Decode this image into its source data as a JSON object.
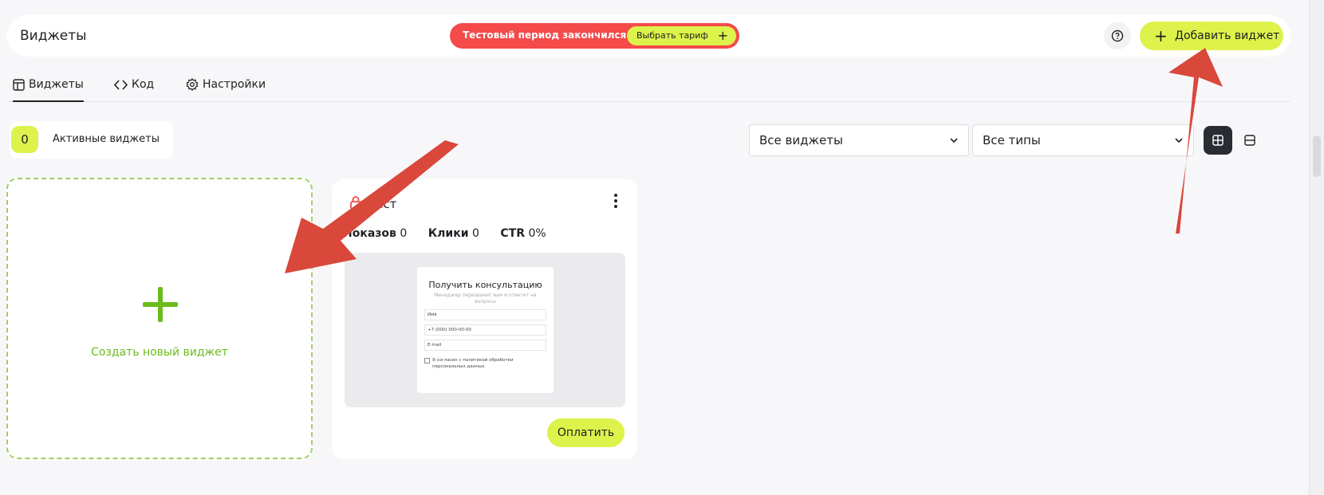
{
  "header": {
    "title": "Виджеты",
    "trial_text": "Тестовый период закончился",
    "tariff_label": "Выбрать тариф",
    "add_label": "Добавить виджет"
  },
  "tabs": [
    {
      "label": "Виджеты",
      "icon": "layout-icon",
      "active": true
    },
    {
      "label": "Код",
      "icon": "code-icon",
      "active": false
    },
    {
      "label": "Настройки",
      "icon": "gear-icon",
      "active": false
    }
  ],
  "active_widgets": {
    "count": "0",
    "label": "Активные виджеты"
  },
  "filters": {
    "widgets": "Все виджеты",
    "types": "Все типы"
  },
  "create_card": {
    "label": "Создать новый виджет"
  },
  "widget": {
    "name": "Тест",
    "stats": {
      "impressions_label": "Показов",
      "impressions": "0",
      "clicks_label": "Клики",
      "clicks": "0",
      "ctr_label": "CTR",
      "ctr": "0%"
    },
    "preview": {
      "title": "Получить консультацию",
      "subtitle": "Менеджер перезвонит вам и ответит на вопросы",
      "field_name": "Имя",
      "field_phone": "+7 (000) 000-00-00",
      "field_email": "E-mail",
      "consent": "Я согласен с политикой обработки персональных данных"
    },
    "pay_label": "Оплатить"
  },
  "colors": {
    "accent": "#ddf24b",
    "danger": "#f44a4a",
    "green": "#6cbb1c",
    "arrow": "#d9483b"
  }
}
